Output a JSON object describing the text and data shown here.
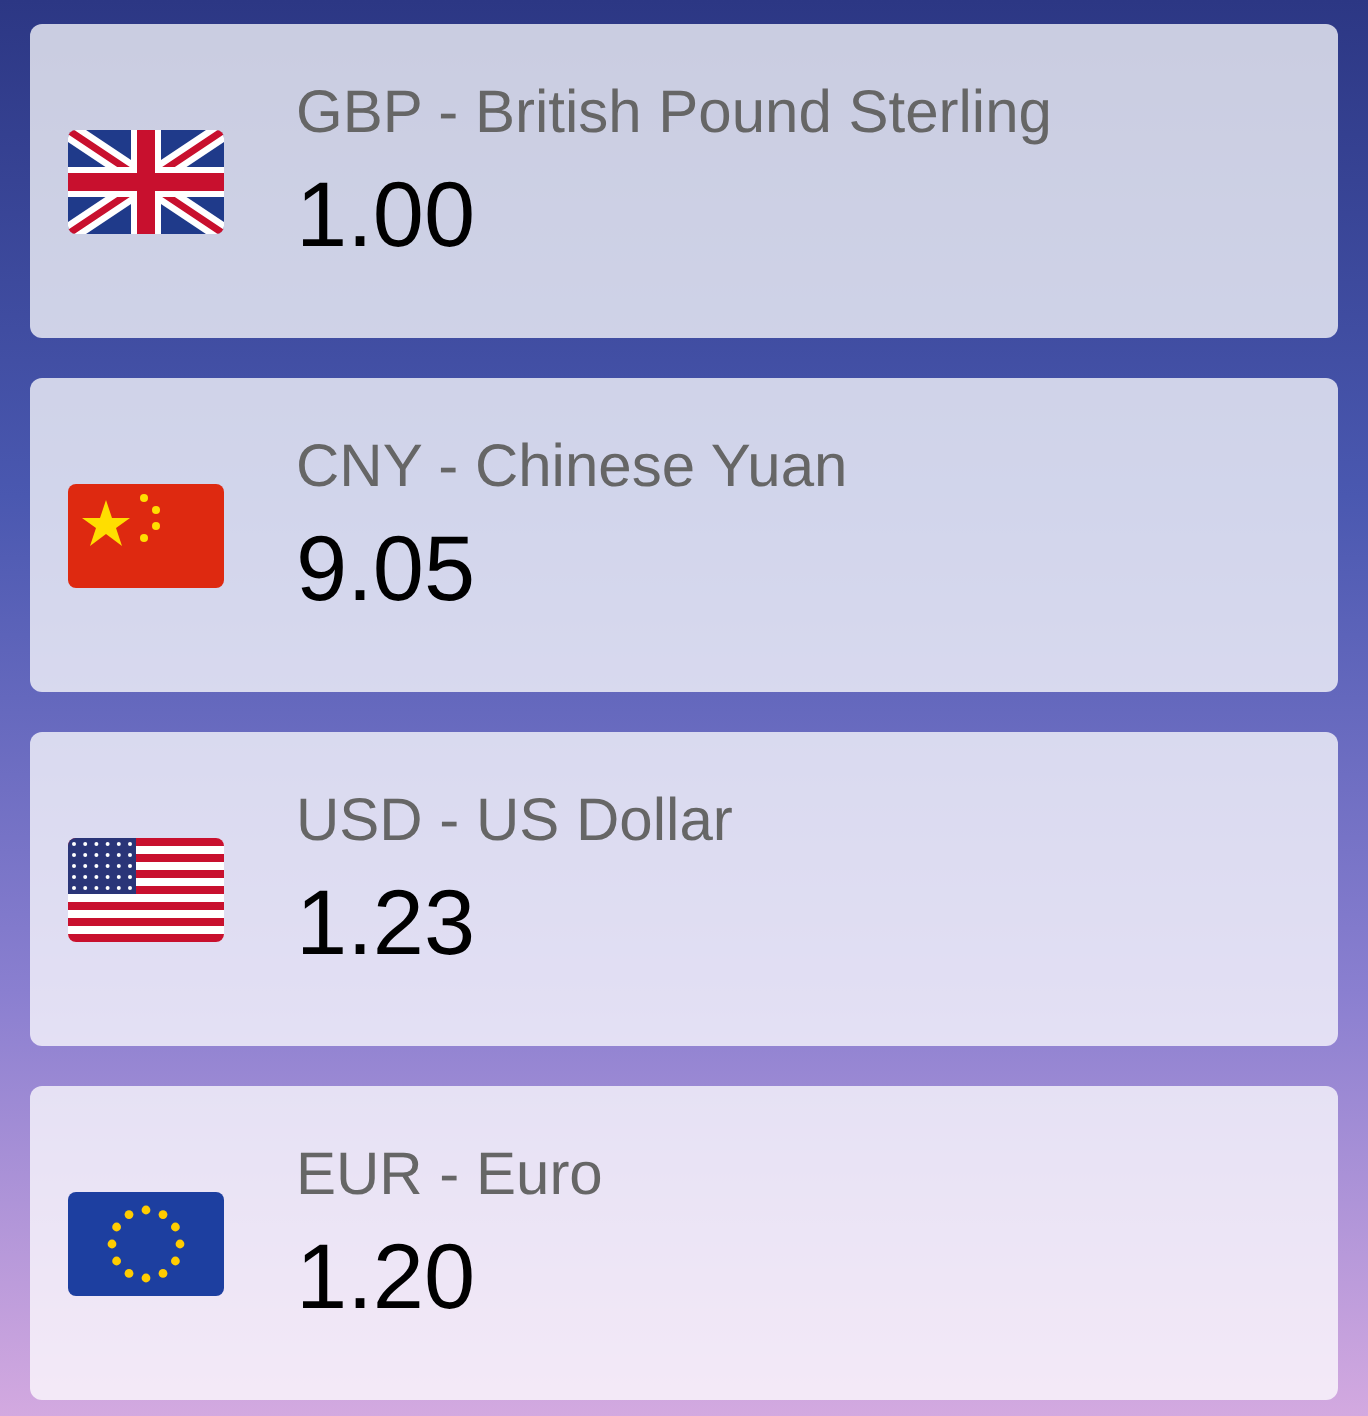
{
  "currencies": [
    {
      "kind": "uk",
      "label": "GBP - British Pound Sterling",
      "value": "1.00"
    },
    {
      "kind": "china",
      "label": "CNY - Chinese Yuan",
      "value": "9.05"
    },
    {
      "kind": "usa",
      "label": "USD - US Dollar",
      "value": "1.23"
    },
    {
      "kind": "eu",
      "label": "EUR - Euro",
      "value": "1.20"
    }
  ]
}
